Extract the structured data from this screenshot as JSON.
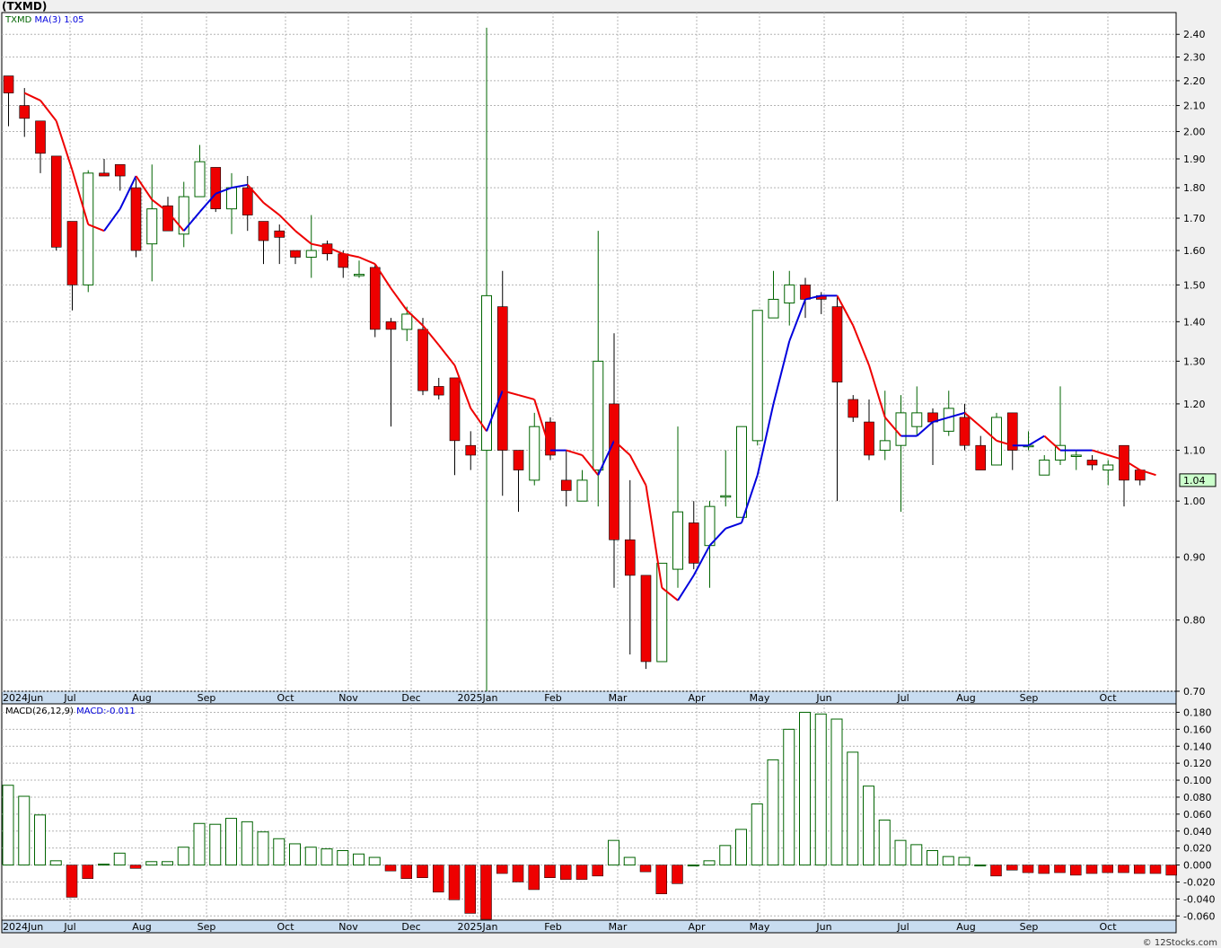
{
  "page": {
    "title": "(TXMD)",
    "credit": "© 12Stocks.com"
  },
  "colors": {
    "up": "#006400",
    "down": "#ee0000",
    "ma_up": "#0000dd",
    "ma_down": "#ee0000",
    "grid": "#b4b4b4",
    "price_box_bg": "#ccffcc"
  },
  "chart_data": [
    {
      "type": "candlestick",
      "legend": {
        "ticker": "TXMD",
        "ma": "MA(3)",
        "ma_value": "1.05"
      },
      "y_scale": "log",
      "ylim": [
        0.7,
        2.5
      ],
      "y_ticks": [
        "0.70",
        "0.80",
        "0.90",
        "1.00",
        "1.10",
        "1.20",
        "1.30",
        "1.40",
        "1.50",
        "1.60",
        "1.70",
        "1.80",
        "1.90",
        "2.00",
        "2.10",
        "2.20",
        "2.30",
        "2.40"
      ],
      "x_labels": [
        "2024Jun",
        "Jul",
        "Aug",
        "Sep",
        "Oct",
        "Nov",
        "Dec",
        "2025Jan",
        "Feb",
        "Mar",
        "Apr",
        "May",
        "Jun",
        "Jul",
        "Aug",
        "Sep",
        "Oct"
      ],
      "last_price": "1.04",
      "candles": [
        {
          "o": 2.22,
          "h": 2.22,
          "l": 2.02,
          "c": 2.15
        },
        {
          "o": 2.1,
          "h": 2.17,
          "l": 1.98,
          "c": 2.05
        },
        {
          "o": 2.04,
          "h": 2.04,
          "l": 1.85,
          "c": 1.92
        },
        {
          "o": 1.91,
          "h": 1.91,
          "l": 1.6,
          "c": 1.61
        },
        {
          "o": 1.69,
          "h": 1.69,
          "l": 1.43,
          "c": 1.5
        },
        {
          "o": 1.5,
          "h": 1.86,
          "l": 1.48,
          "c": 1.85
        },
        {
          "o": 1.85,
          "h": 1.9,
          "l": 1.84,
          "c": 1.84
        },
        {
          "o": 1.88,
          "h": 1.88,
          "l": 1.79,
          "c": 1.84
        },
        {
          "o": 1.8,
          "h": 1.83,
          "l": 1.58,
          "c": 1.6
        },
        {
          "o": 1.62,
          "h": 1.88,
          "l": 1.51,
          "c": 1.73
        },
        {
          "o": 1.74,
          "h": 1.77,
          "l": 1.66,
          "c": 1.66
        },
        {
          "o": 1.65,
          "h": 1.82,
          "l": 1.61,
          "c": 1.77
        },
        {
          "o": 1.77,
          "h": 1.95,
          "l": 1.77,
          "c": 1.89
        },
        {
          "o": 1.87,
          "h": 1.87,
          "l": 1.72,
          "c": 1.73
        },
        {
          "o": 1.73,
          "h": 1.85,
          "l": 1.65,
          "c": 1.8
        },
        {
          "o": 1.8,
          "h": 1.84,
          "l": 1.66,
          "c": 1.71
        },
        {
          "o": 1.69,
          "h": 1.69,
          "l": 1.56,
          "c": 1.63
        },
        {
          "o": 1.66,
          "h": 1.68,
          "l": 1.56,
          "c": 1.64
        },
        {
          "o": 1.6,
          "h": 1.6,
          "l": 1.56,
          "c": 1.58
        },
        {
          "o": 1.58,
          "h": 1.71,
          "l": 1.52,
          "c": 1.6
        },
        {
          "o": 1.62,
          "h": 1.63,
          "l": 1.57,
          "c": 1.59
        },
        {
          "o": 1.59,
          "h": 1.6,
          "l": 1.52,
          "c": 1.55
        },
        {
          "o": 1.53,
          "h": 1.57,
          "l": 1.52,
          "c": 1.53
        },
        {
          "o": 1.55,
          "h": 1.56,
          "l": 1.36,
          "c": 1.38
        },
        {
          "o": 1.4,
          "h": 1.41,
          "l": 1.15,
          "c": 1.38
        },
        {
          "o": 1.38,
          "h": 1.44,
          "l": 1.35,
          "c": 1.42
        },
        {
          "o": 1.38,
          "h": 1.41,
          "l": 1.22,
          "c": 1.23
        },
        {
          "o": 1.24,
          "h": 1.26,
          "l": 1.21,
          "c": 1.22
        },
        {
          "o": 1.26,
          "h": 1.26,
          "l": 1.05,
          "c": 1.12
        },
        {
          "o": 1.11,
          "h": 1.14,
          "l": 1.06,
          "c": 1.09
        },
        {
          "o": 1.1,
          "h": 2.43,
          "l": 0.7,
          "c": 1.47
        },
        {
          "o": 1.44,
          "h": 1.54,
          "l": 1.01,
          "c": 1.1
        },
        {
          "o": 1.1,
          "h": 1.1,
          "l": 0.98,
          "c": 1.06
        },
        {
          "o": 1.04,
          "h": 1.18,
          "l": 1.03,
          "c": 1.15
        },
        {
          "o": 1.16,
          "h": 1.17,
          "l": 1.08,
          "c": 1.09
        },
        {
          "o": 1.04,
          "h": 1.1,
          "l": 0.99,
          "c": 1.02
        },
        {
          "o": 1.0,
          "h": 1.06,
          "l": 1.0,
          "c": 1.04
        },
        {
          "o": 1.06,
          "h": 1.66,
          "l": 0.99,
          "c": 1.3
        },
        {
          "o": 1.2,
          "h": 1.37,
          "l": 0.85,
          "c": 0.93
        },
        {
          "o": 0.93,
          "h": 1.04,
          "l": 0.75,
          "c": 0.87
        },
        {
          "o": 0.87,
          "h": 0.87,
          "l": 0.73,
          "c": 0.74
        },
        {
          "o": 0.74,
          "h": 0.89,
          "l": 0.74,
          "c": 0.89
        },
        {
          "o": 0.88,
          "h": 1.15,
          "l": 0.85,
          "c": 0.98
        },
        {
          "o": 0.96,
          "h": 1.0,
          "l": 0.88,
          "c": 0.89
        },
        {
          "o": 0.92,
          "h": 1.0,
          "l": 0.85,
          "c": 0.99
        },
        {
          "o": 1.01,
          "h": 1.1,
          "l": 0.99,
          "c": 1.01
        },
        {
          "o": 0.97,
          "h": 1.15,
          "l": 0.97,
          "c": 1.15
        },
        {
          "o": 1.12,
          "h": 1.43,
          "l": 1.11,
          "c": 1.43
        },
        {
          "o": 1.41,
          "h": 1.54,
          "l": 1.41,
          "c": 1.46
        },
        {
          "o": 1.45,
          "h": 1.54,
          "l": 1.39,
          "c": 1.5
        },
        {
          "o": 1.5,
          "h": 1.52,
          "l": 1.41,
          "c": 1.46
        },
        {
          "o": 1.47,
          "h": 1.48,
          "l": 1.42,
          "c": 1.46
        },
        {
          "o": 1.44,
          "h": 1.47,
          "l": 1.0,
          "c": 1.25
        },
        {
          "o": 1.21,
          "h": 1.22,
          "l": 1.16,
          "c": 1.17
        },
        {
          "o": 1.16,
          "h": 1.21,
          "l": 1.08,
          "c": 1.09
        },
        {
          "o": 1.1,
          "h": 1.23,
          "l": 1.08,
          "c": 1.12
        },
        {
          "o": 1.11,
          "h": 1.22,
          "l": 0.98,
          "c": 1.18
        },
        {
          "o": 1.15,
          "h": 1.24,
          "l": 1.13,
          "c": 1.18
        },
        {
          "o": 1.18,
          "h": 1.19,
          "l": 1.07,
          "c": 1.16
        },
        {
          "o": 1.14,
          "h": 1.23,
          "l": 1.13,
          "c": 1.19
        },
        {
          "o": 1.17,
          "h": 1.2,
          "l": 1.1,
          "c": 1.11
        },
        {
          "o": 1.11,
          "h": 1.13,
          "l": 1.06,
          "c": 1.06
        },
        {
          "o": 1.07,
          "h": 1.18,
          "l": 1.07,
          "c": 1.17
        },
        {
          "o": 1.18,
          "h": 1.18,
          "l": 1.06,
          "c": 1.1
        },
        {
          "o": 1.11,
          "h": 1.14,
          "l": 1.1,
          "c": 1.11
        },
        {
          "o": 1.05,
          "h": 1.09,
          "l": 1.05,
          "c": 1.08
        },
        {
          "o": 1.08,
          "h": 1.24,
          "l": 1.07,
          "c": 1.11
        },
        {
          "o": 1.09,
          "h": 1.1,
          "l": 1.06,
          "c": 1.09
        },
        {
          "o": 1.08,
          "h": 1.09,
          "l": 1.06,
          "c": 1.07
        },
        {
          "o": 1.06,
          "h": 1.08,
          "l": 1.03,
          "c": 1.07
        },
        {
          "o": 1.11,
          "h": 1.11,
          "l": 0.99,
          "c": 1.04
        },
        {
          "o": 1.06,
          "h": 1.06,
          "l": 1.03,
          "c": 1.04
        }
      ],
      "ma": [
        2.15,
        2.12,
        2.04,
        1.86,
        1.68,
        1.66,
        1.73,
        1.84,
        1.76,
        1.72,
        1.66,
        1.72,
        1.78,
        1.8,
        1.81,
        1.75,
        1.71,
        1.66,
        1.62,
        1.61,
        1.59,
        1.58,
        1.56,
        1.49,
        1.43,
        1.39,
        1.34,
        1.29,
        1.19,
        1.14,
        1.23,
        1.22,
        1.21,
        1.1,
        1.1,
        1.09,
        1.05,
        1.12,
        1.09,
        1.03,
        0.85,
        0.83,
        0.87,
        0.92,
        0.95,
        0.96,
        1.05,
        1.2,
        1.35,
        1.46,
        1.47,
        1.47,
        1.39,
        1.29,
        1.17,
        1.13,
        1.13,
        1.16,
        1.17,
        1.18,
        1.15,
        1.12,
        1.11,
        1.11,
        1.13,
        1.1,
        1.1,
        1.1,
        1.09,
        1.08,
        1.06,
        1.05
      ]
    },
    {
      "type": "bar",
      "legend": {
        "name": "MACD(26,12,9)",
        "label": "MACD:",
        "value": "-0.011"
      },
      "ylim": [
        -0.065,
        0.19
      ],
      "y_ticks": [
        "0.180",
        "0.160",
        "0.140",
        "0.120",
        "0.100",
        "0.080",
        "0.060",
        "0.040",
        "0.020",
        "0.000",
        "-0.020",
        "-0.040",
        "-0.060"
      ],
      "x_labels": [
        "2024Jun",
        "Jul",
        "Aug",
        "Sep",
        "Oct",
        "Nov",
        "Dec",
        "2025Jan",
        "Feb",
        "Mar",
        "Apr",
        "May",
        "Jun",
        "Jul",
        "Aug",
        "Sep",
        "Oct"
      ],
      "values": [
        0.094,
        0.081,
        0.059,
        0.005,
        -0.038,
        -0.016,
        0.001,
        0.014,
        -0.004,
        0.004,
        0.004,
        0.021,
        0.049,
        0.048,
        0.055,
        0.051,
        0.039,
        0.031,
        0.025,
        0.021,
        0.019,
        0.017,
        0.013,
        0.009,
        -0.007,
        -0.016,
        -0.015,
        -0.032,
        -0.041,
        -0.057,
        -0.064,
        -0.01,
        -0.02,
        -0.029,
        -0.015,
        -0.017,
        -0.017,
        -0.013,
        0.029,
        0.009,
        -0.008,
        -0.034,
        -0.022,
        0.0,
        0.005,
        0.023,
        0.042,
        0.072,
        0.124,
        0.16,
        0.18,
        0.178,
        0.172,
        0.133,
        0.093,
        0.053,
        0.029,
        0.024,
        0.017,
        0.01,
        0.009,
        0.0,
        -0.013,
        -0.006,
        -0.009,
        -0.01,
        -0.009,
        -0.012,
        -0.01,
        -0.009,
        -0.009,
        -0.01,
        -0.01,
        -0.012
      ]
    }
  ]
}
